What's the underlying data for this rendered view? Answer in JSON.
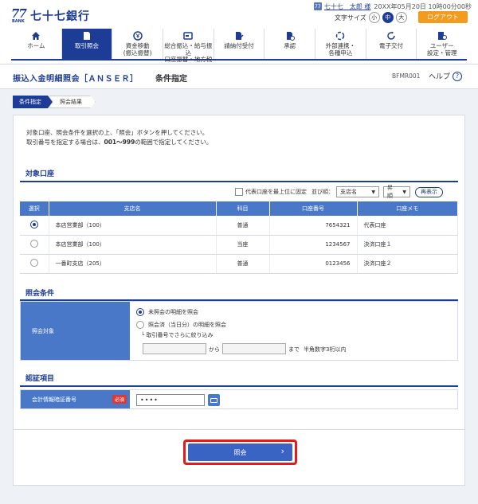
{
  "header": {
    "logo_mark": "77",
    "logo_bank": "BANK",
    "bank_name": "七十七銀行",
    "user_name": "七十七　太郎 様",
    "last_login": "20XX年05月20日 10時00分00秒",
    "font_size_label": "文字サイズ",
    "font_small": "小",
    "font_medium": "中",
    "font_large": "大",
    "logout": "ログアウト"
  },
  "nav": [
    {
      "l1": "ホーム",
      "l2": "",
      "icon": "home-icon",
      "active": false
    },
    {
      "l1": "取引照会",
      "l2": "",
      "icon": "document-icon",
      "active": true
    },
    {
      "l1": "資金移動",
      "l2": "(振込振替)",
      "icon": "yen-transfer-icon",
      "active": false
    },
    {
      "l1": "総合振込・給与振込",
      "l2": "口座振替・地方税",
      "icon": "card-icon",
      "active": false
    },
    {
      "l1": "請納付受付",
      "l2": "",
      "icon": "pen-document-icon",
      "active": false
    },
    {
      "l1": "承認",
      "l2": "",
      "icon": "approve-icon",
      "active": false
    },
    {
      "l1": "外部連携・",
      "l2": "各種申込",
      "icon": "link-icon",
      "active": false
    },
    {
      "l1": "電子交付",
      "l2": "",
      "icon": "refresh-icon",
      "active": false
    },
    {
      "l1": "ユーザー",
      "l2": "設定・管理",
      "icon": "user-settings-icon",
      "active": false
    }
  ],
  "page": {
    "title": "振込入金明細照会［ＡＮＳＥＲ］",
    "subtitle": "条件指定",
    "screen_id": "BFMR001",
    "help": "ヘルプ"
  },
  "steps": [
    "条件指定",
    "照会結果"
  ],
  "intro": {
    "line1": "対象口座、照会条件を選択の上、「照会」ボタンを押してください。",
    "line2_a": "取引番号を指定する場合は、",
    "line2_b": "001〜999",
    "line2_c": "の範囲で指定してください。"
  },
  "accounts_section": {
    "title": "対象口座",
    "pin_label": "代表口座を最上位に固定",
    "sort_label": "並び順：",
    "sort_key": "支店名",
    "sort_order": "昇順",
    "redisplay": "再表示",
    "columns": [
      "選択",
      "支店名",
      "科目",
      "口座番号",
      "口座メモ"
    ],
    "rows": [
      {
        "branch": "本店営業部（100）",
        "type": "普通",
        "number": "7654321",
        "memo": "代表口座",
        "selected": true
      },
      {
        "branch": "本店営業部（100）",
        "type": "当座",
        "number": "1234567",
        "memo": "決済口座１",
        "selected": false
      },
      {
        "branch": "一番町支店（205）",
        "type": "普通",
        "number": "0123456",
        "memo": "決済口座２",
        "selected": false
      }
    ]
  },
  "conditions_section": {
    "title": "照会条件",
    "label": "照会対象",
    "option1": "未照会の明細を照会",
    "option2": "照会済（当日分）の明細を照会",
    "narrow": "└ 取引番号でさらに絞り込み",
    "from": "から",
    "to": "まで",
    "hint": "半角数字3桁以内"
  },
  "auth_section": {
    "title": "認証項目",
    "label": "会計情報暗証番号",
    "required": "必須",
    "value": "••••"
  },
  "submit": {
    "label": "照会",
    "chevron": "›"
  }
}
